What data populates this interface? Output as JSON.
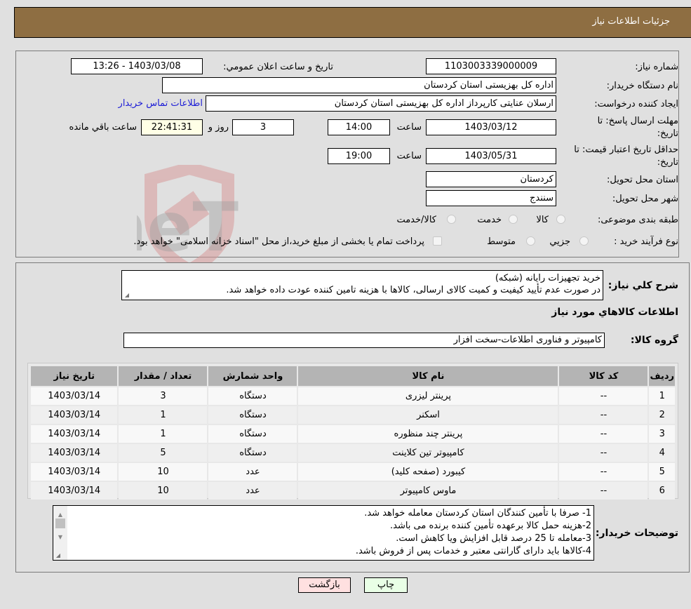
{
  "header": {
    "title": "جزئیات اطلاعات نیاز"
  },
  "form": {
    "need_number": {
      "label": "شماره نیاز:",
      "value": "1103003339000009"
    },
    "announce_datetime": {
      "label": "تاریخ و ساعت اعلان عمومي:",
      "value": "1403/03/08 - 13:26"
    },
    "buyer_org": {
      "label": "نام دستگاه خريدار:",
      "value": "اداره کل بهزیستی استان کردستان"
    },
    "requester": {
      "label": "ایجاد کننده درخواست:",
      "value": "ارسلان  عنایتی کارپرداز اداره کل بهزیستی استان کردستان"
    },
    "buyer_contact_link": "اطلاعات تماس خريدار",
    "reply_deadline": {
      "label_line1": "مهلت ارسال پاسخ: تا",
      "label_line2": "تاریخ:",
      "date": "1403/03/12",
      "time_label": "ساعت",
      "time": "14:00",
      "days": "3",
      "days_label": "روز و",
      "remaining": "22:41:31",
      "remaining_label": "ساعت باقي مانده"
    },
    "price_validity": {
      "label_line1": "حداقل تاریخ اعتبار قیمت: تا",
      "label_line2": "تاریخ:",
      "date": "1403/05/31",
      "time_label": "ساعت",
      "time": "19:00"
    },
    "delivery_province": {
      "label": "استان محل تحویل:",
      "value": "کردستان"
    },
    "delivery_city": {
      "label": "شهر محل تحویل:",
      "value": "سنندج"
    },
    "category": {
      "label": "طبقه بندی موضوعی:",
      "options": [
        "کالا",
        "خدمت",
        "کالا/خدمت"
      ]
    },
    "purchase_type": {
      "label": "نوع فرآیند خرید :",
      "options": [
        "جزيي",
        "متوسط"
      ],
      "payment_note": "پرداخت تمام یا بخشی از مبلغ خرید،از محل \"اسناد خزانه اسلامی\" خواهد بود."
    }
  },
  "description": {
    "label": "شرح کلي نياز:",
    "line1": "خرید تجهیزات رایانه (شبکه)",
    "line2": "در صورت عدم تأیید کیفیت و کمیت کالای ارسالی، کالاها با هزینه تامین کننده عودت داده خواهد شد."
  },
  "goods_section_title": "اطلاعات کالاهاي مورد نياز",
  "goods_group": {
    "label": "گروه کالا:",
    "value": "کامپیوتر و فناوری اطلاعات-سخت افزار"
  },
  "table": {
    "headers": [
      "رديف",
      "کد کالا",
      "نام کالا",
      "واحد شمارش",
      "تعداد / مقدار",
      "تاریخ نیاز"
    ],
    "rows": [
      [
        "1",
        "--",
        "پرینتر لیزری",
        "دستگاه",
        "3",
        "1403/03/14"
      ],
      [
        "2",
        "--",
        "اسکنر",
        "دستگاه",
        "1",
        "1403/03/14"
      ],
      [
        "3",
        "--",
        "پرینتر چند منظوره",
        "دستگاه",
        "1",
        "1403/03/14"
      ],
      [
        "4",
        "--",
        "کامپیوتر تین کلاینت",
        "دستگاه",
        "5",
        "1403/03/14"
      ],
      [
        "5",
        "--",
        "کیبورد (صفحه کلید)",
        "عدد",
        "10",
        "1403/03/14"
      ],
      [
        "6",
        "--",
        "ماوس کامپیوتر",
        "عدد",
        "10",
        "1403/03/14"
      ]
    ]
  },
  "buyer_notes": {
    "label": "توضيحات خريدار:",
    "lines": [
      "1- صرفا با تأمین کنندگان استان کردستان معامله خواهد شد.",
      "2-هزینه حمل کالا برعهده تأمین کننده برنده می باشد.",
      "3-معامله تا 25 درصد قابل افزایش ویا کاهش است.",
      "4-کالاها باید دارای گارانتی معتبر و خدمات پس از فروش باشد."
    ]
  },
  "buttons": {
    "print": "چاپ",
    "back": "بازگشت"
  },
  "watermark": {
    "text": "AriaTender.neT"
  },
  "colors": {
    "header_bg": "#8e6e42",
    "link": "#1c1cd6",
    "back_btn": "#ffe0e0",
    "print_btn": "#e9ffe6",
    "remaining_bg": "#ffffe6"
  }
}
